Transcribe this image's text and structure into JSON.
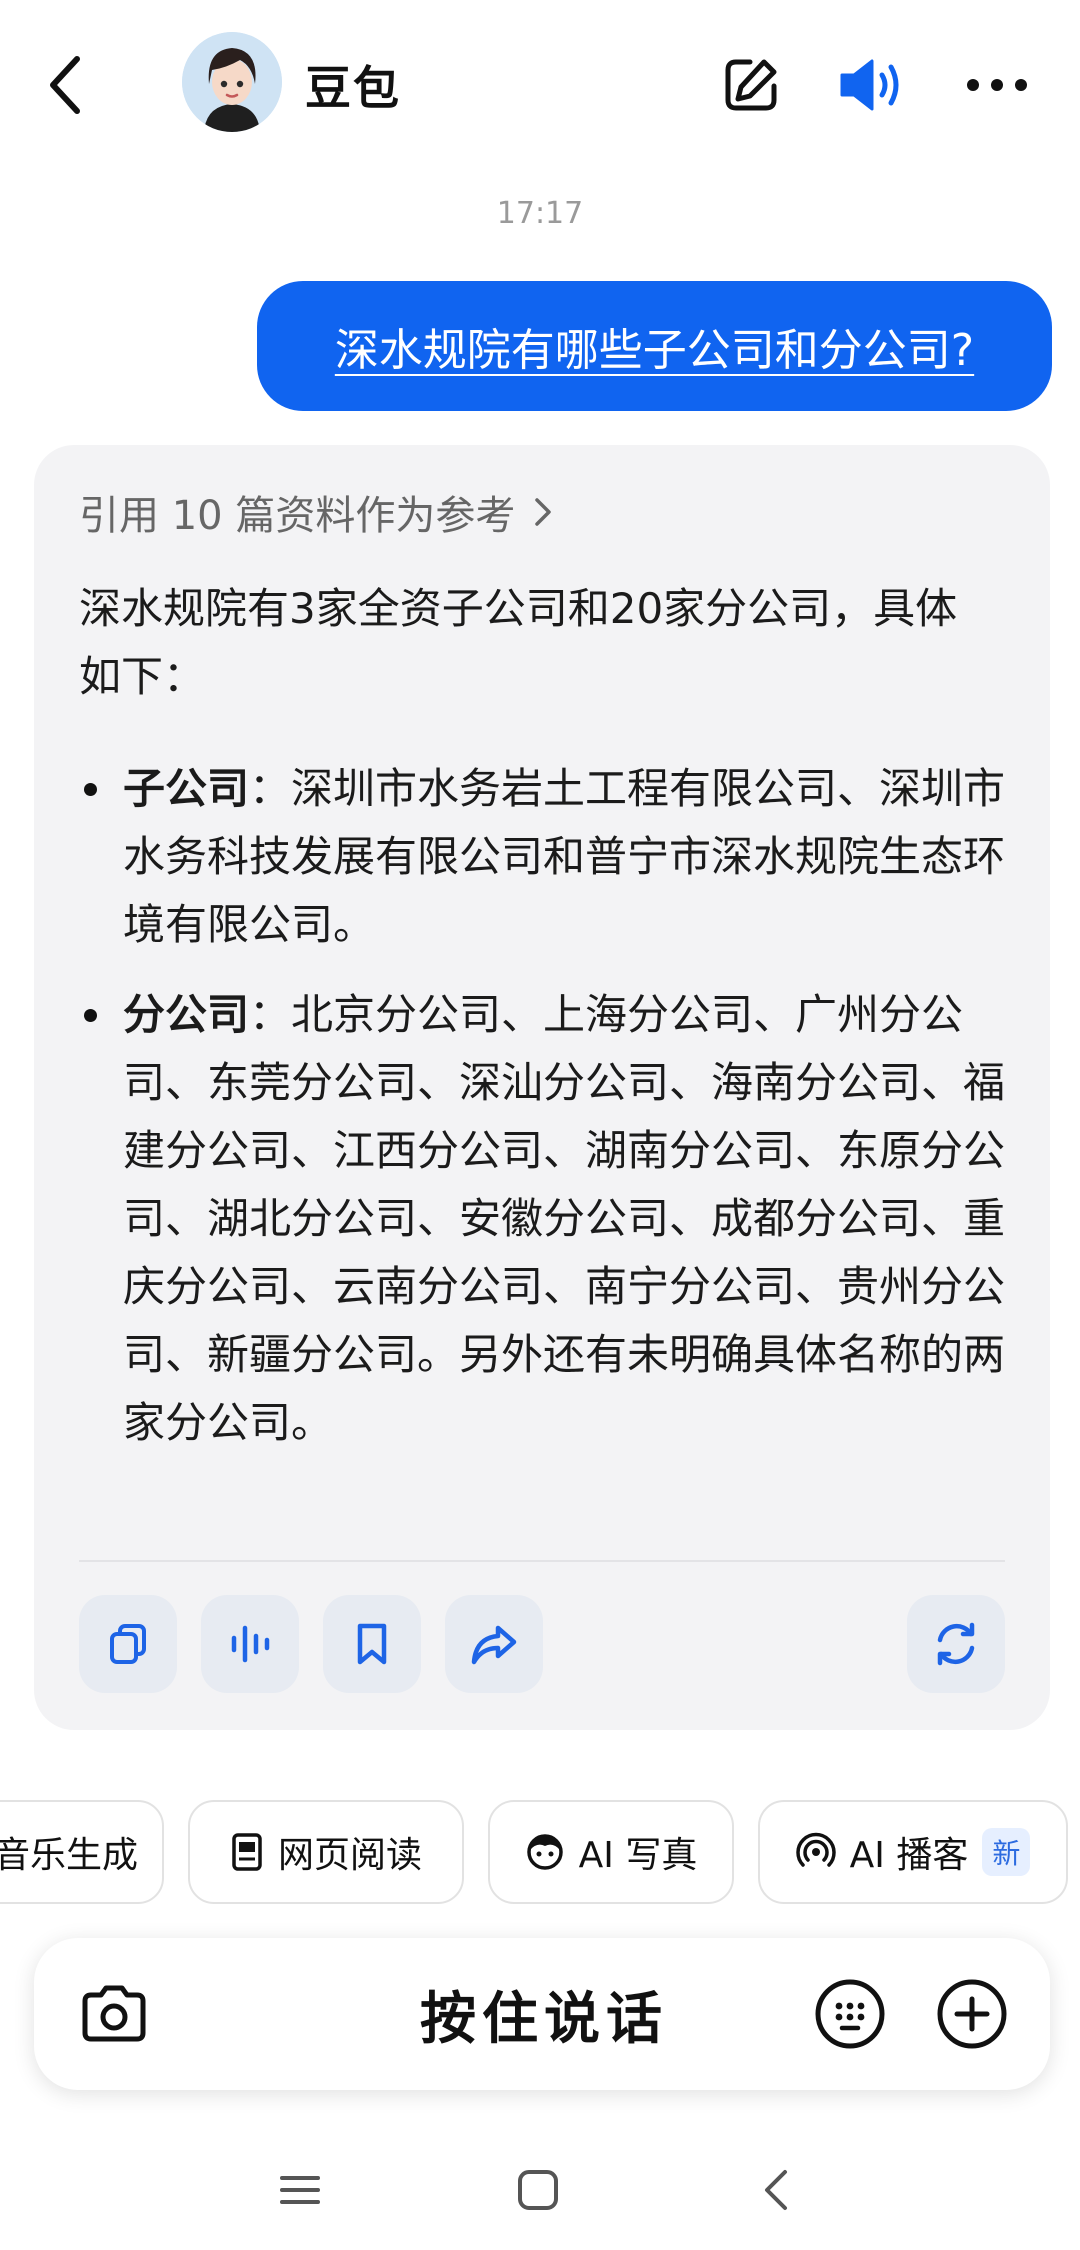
{
  "header": {
    "title": "豆包",
    "icons": [
      "back-icon",
      "edit-icon",
      "speaker-icon",
      "more-icon"
    ]
  },
  "chat": {
    "timestamp": "17:17",
    "user_message": "深水规院有哪些子公司和分公司?",
    "reply": {
      "reference_label": "引用 10 篇资料作为参考",
      "intro": "深水规院有3家全资子公司和20家分公司，具体如下：",
      "bullets": [
        {
          "term": "子公司",
          "text": "：深圳市水务岩土工程有限公司、深圳市水务科技发展有限公司和普宁市深水规院生态环境有限公司。"
        },
        {
          "term": "分公司",
          "text": "：北京分公司、上海分公司、广州分公司、东莞分公司、深汕分公司、海南分公司、福建分公司、江西分公司、湖南分公司、东原分公司、湖北分公司、安徽分公司、成都分公司、重庆分公司、云南分公司、南宁分公司、贵州分公司、新疆分公司。另外还有未明确具体名称的两家分公司。"
        }
      ],
      "actions": [
        "copy-icon",
        "voice-icon",
        "bookmark-icon",
        "share-icon",
        "regenerate-icon"
      ]
    }
  },
  "chips": [
    {
      "label": "音乐生成",
      "icon": "music-icon"
    },
    {
      "label": "网页阅读",
      "icon": "document-icon"
    },
    {
      "label": "AI 写真",
      "icon": "face-icon"
    },
    {
      "label": "AI 播客",
      "icon": "podcast-icon",
      "badge": "新"
    }
  ],
  "input_bar": {
    "hold_to_talk": "按住说话"
  },
  "colors": {
    "accent": "#1064f0",
    "card_bg": "#f3f3f5",
    "action_icon": "#1e64e6"
  }
}
